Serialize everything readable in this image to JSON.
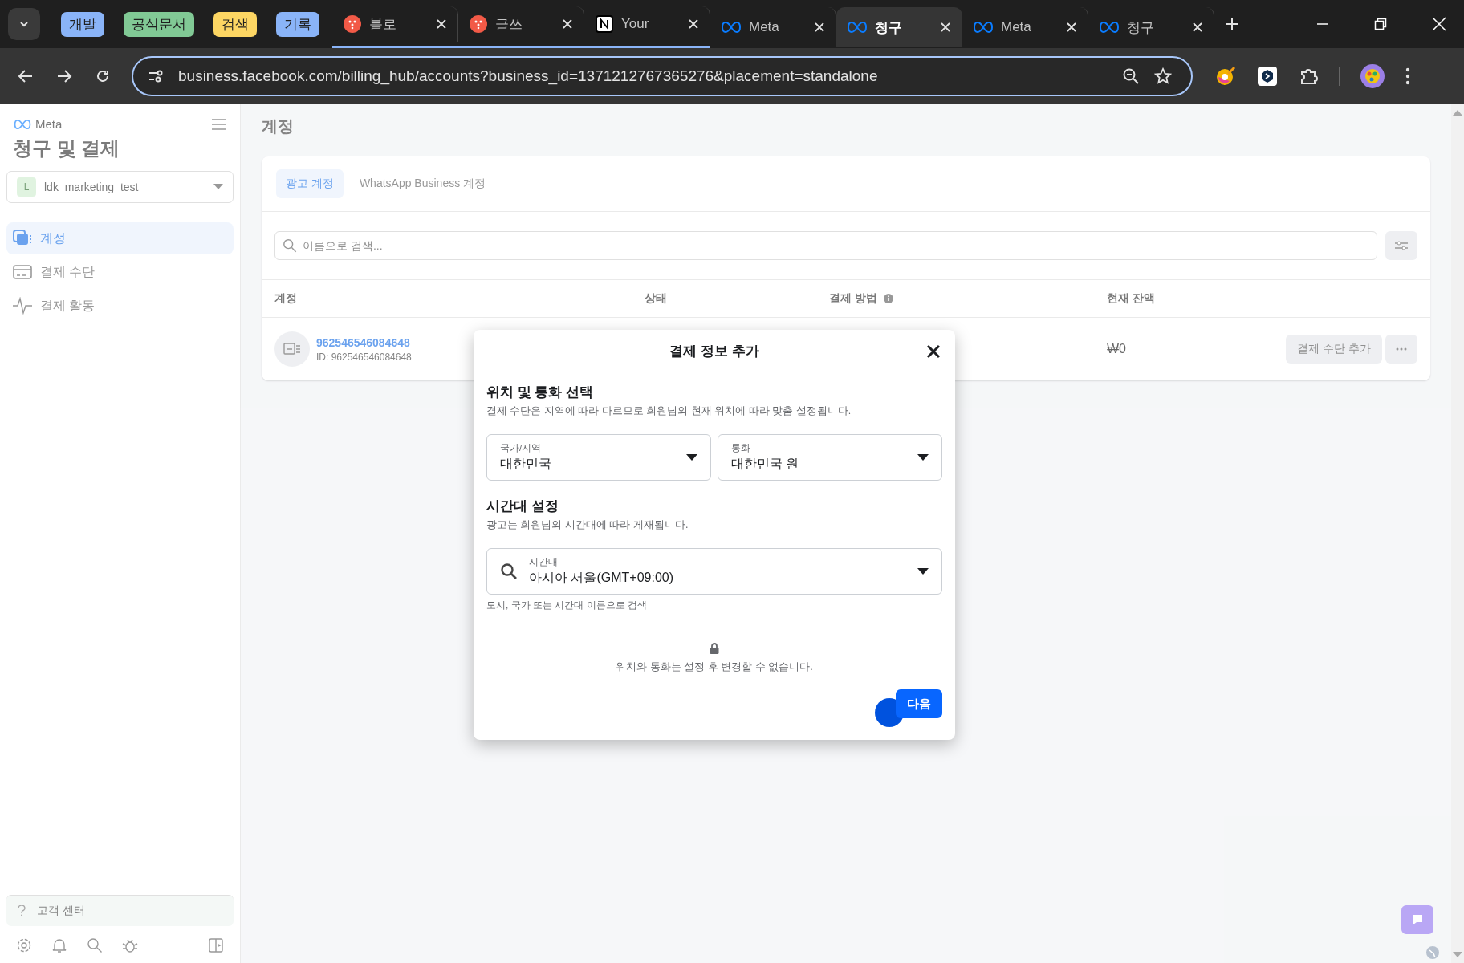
{
  "browser": {
    "tab_strip": [
      {
        "kind": "group",
        "label": "개발",
        "color": "#8ab4f8"
      },
      {
        "kind": "group",
        "label": "공식문서",
        "color": "#81c995"
      },
      {
        "kind": "group",
        "label": "검색",
        "color": "#fdd663"
      },
      {
        "kind": "group",
        "label": "기록",
        "color": "#8ab4f8",
        "tabs": [
          {
            "title": "블로",
            "selected": false
          },
          {
            "title": "글쓰",
            "selected": false
          },
          {
            "title": "Your",
            "selected": false
          }
        ]
      },
      {
        "kind": "tab",
        "title": "Meta",
        "selected": false
      },
      {
        "kind": "tab",
        "title": "청구",
        "selected": true
      },
      {
        "kind": "tab",
        "title": "Meta",
        "selected": false
      },
      {
        "kind": "tab",
        "title": "청구",
        "selected": false
      }
    ],
    "url": "business.facebook.com/billing_hub/accounts?business_id=1371212767365276&placement=standalone"
  },
  "sidebar": {
    "logo": "Meta",
    "title": "청구 및 결제",
    "account": {
      "initial": "L",
      "name": "ldk_marketing_test"
    },
    "items": [
      {
        "label": "계정",
        "selected": true
      },
      {
        "label": "결제 수단",
        "selected": false
      },
      {
        "label": "결제 활동",
        "selected": false
      }
    ],
    "help": "고객 센터"
  },
  "main": {
    "heading": "계정",
    "tabs": [
      {
        "label": "광고 계정",
        "selected": true
      },
      {
        "label": "WhatsApp Business 계정",
        "selected": false
      }
    ],
    "search": {
      "placeholder": "이름으로 검색..."
    },
    "columns": [
      "계정",
      "상태",
      "결제 방법",
      "현재 잔액"
    ],
    "rows": [
      {
        "name": "962546546084648",
        "id": "ID: 962546546084648",
        "balance": "₩0",
        "action": "결제 수단 추가"
      }
    ]
  },
  "dialog": {
    "title": "결제 정보 추가",
    "location_heading": "위치 및 통화 선택",
    "location_text": "결제 수단은 지역에 따라 다르므로 회원님의 현재 위치에 따라 맞춤 설정됩니다.",
    "selects": [
      {
        "label": "국가/지역",
        "value": "대한민국"
      },
      {
        "label": "통화",
        "value": "대한민국 원"
      }
    ],
    "timezone_heading": "시간대 설정",
    "timezone_text": "광고는 회원님의 시간대에 따라 게재됩니다.",
    "timezone": {
      "label": "시간대",
      "value": "아시아 서울(GMT+09:00)",
      "helper": "도시, 국가 또는 시간대 이름으로 검색"
    },
    "note": "위치와 통화는 설정 후 변경할 수 없습니다.",
    "next": "다음"
  }
}
